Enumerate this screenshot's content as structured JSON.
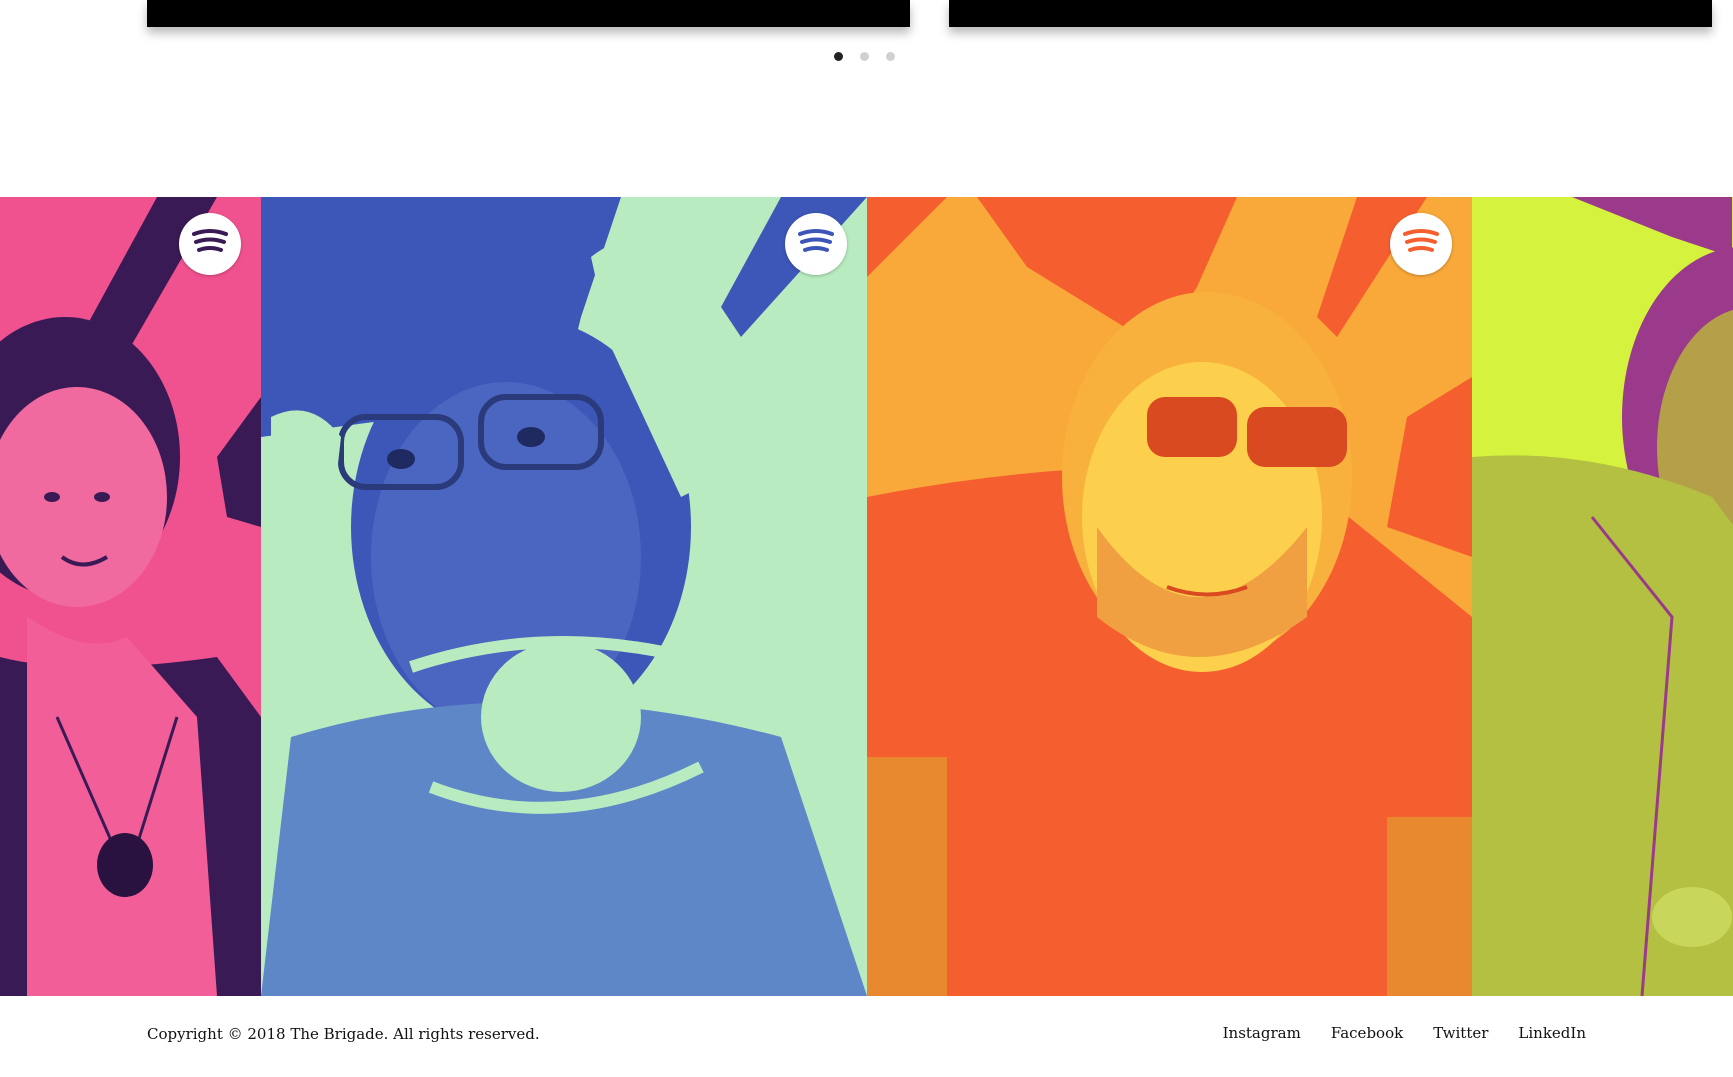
{
  "carousel": {
    "slide_count": 2,
    "dots": 3,
    "active_dot": 1
  },
  "gallery": {
    "panels": [
      {
        "name": "pink-portrait",
        "bg": "#f0528f",
        "shade": "#3a1a55",
        "spotify_color": "#3a1a55"
      },
      {
        "name": "blue-portrait",
        "bg": "#b8ecc0",
        "shade": "#3d57b8",
        "spotify_color": "#3d57b8"
      },
      {
        "name": "orange-portrait",
        "bg": "#f9a93a",
        "shade": "#f55f30",
        "spotify_color": "#f55f30"
      },
      {
        "name": "lime-portrait",
        "bg": "#d4f23e",
        "shade": "#9b3a8a",
        "spotify_color": "#9b3a8a"
      }
    ],
    "icon": "spotify-icon"
  },
  "footer": {
    "copyright": "Copyright © 2018 The Brigade. All rights reserved.",
    "links": [
      "Instagram",
      "Facebook",
      "Twitter",
      "LinkedIn"
    ]
  }
}
